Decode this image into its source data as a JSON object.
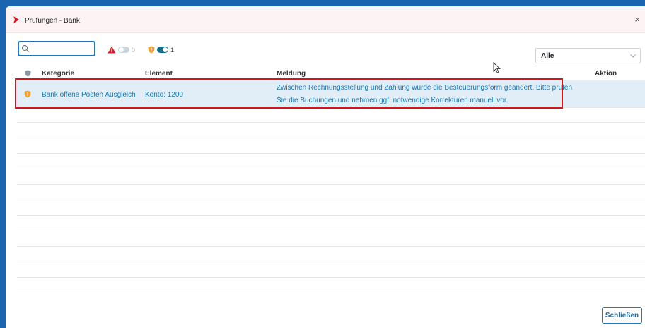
{
  "window": {
    "title": "Prüfungen - Bank",
    "close_glyph": "×"
  },
  "toolbar": {
    "search_value": "",
    "error_filter": {
      "icon": "warning-icon",
      "enabled": false,
      "count": "0",
      "color": "#d0202a"
    },
    "warning_filter": {
      "icon": "shield-icon",
      "enabled": true,
      "count": "1",
      "color": "#f0a030"
    },
    "scope_select": {
      "value": "Alle"
    }
  },
  "table": {
    "headers": {
      "status": "shield-icon",
      "category": "Kategorie",
      "element": "Element",
      "message": "Meldung",
      "action": "Aktion"
    },
    "rows": [
      {
        "status_icon": "shield-icon",
        "category": "Bank offene Posten Ausgleich",
        "element": "Konto: 1200",
        "message_line1": "Zwischen Rechnungsstellung und Zahlung wurde die Besteuerungsform geändert. Bitte prüfen",
        "message_line2": "Sie die Buchungen und nehmen ggf. notwendige Korrekturen manuell vor.",
        "action": ""
      }
    ]
  },
  "footer": {
    "close_label": "Schließen"
  },
  "colors": {
    "accent": "#1f79b8",
    "selected_row": "#e2eef7",
    "link_text": "#1a78ae",
    "highlight_border": "#d8141b",
    "brand": "#d8141b"
  }
}
